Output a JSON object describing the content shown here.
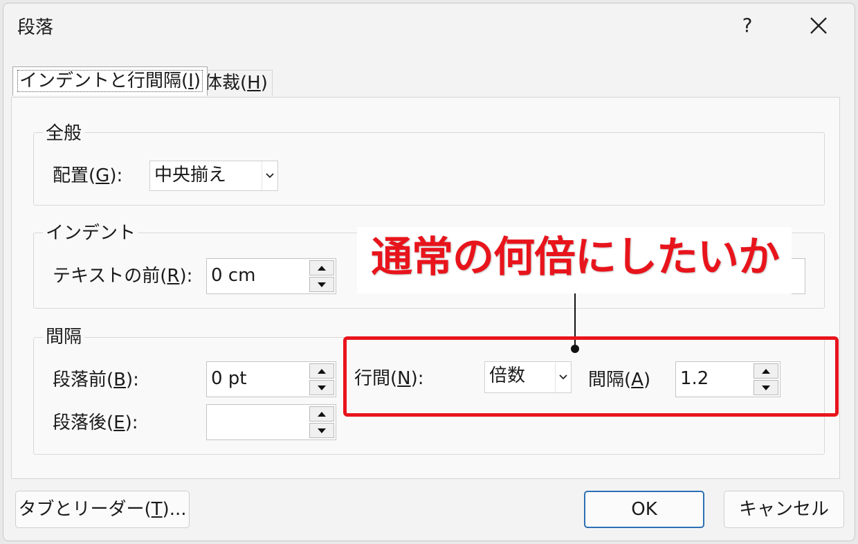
{
  "dialog": {
    "title": "段落",
    "help_label": "?",
    "close_icon": "close-icon"
  },
  "tabs": [
    {
      "label": "インデントと行間隔(I)",
      "pre": "インデントと行間隔(",
      "mn": "I",
      "post": ")",
      "active": true
    },
    {
      "label": "体裁(H)",
      "pre": "体裁(",
      "mn": "H",
      "post": ")",
      "active": false
    }
  ],
  "general": {
    "group_label": "全般",
    "alignment_label_pre": "配置(",
    "alignment_label_mn": "G",
    "alignment_label_post": "):",
    "alignment_value": "中央揃え"
  },
  "indent": {
    "group_label": "インデント",
    "before_text_label_pre": "テキストの前(",
    "before_text_label_mn": "R",
    "before_text_label_post": "):",
    "before_text_value": "0 cm"
  },
  "spacing": {
    "group_label": "間隔",
    "before_label_pre": "段落前(",
    "before_label_mn": "B",
    "before_label_post": "):",
    "before_value": "0 pt",
    "after_label_pre": "段落後(",
    "after_label_mn": "E",
    "after_label_post": "):",
    "after_value": "",
    "line_spacing_label_pre": "行間(",
    "line_spacing_label_mn": "N",
    "line_spacing_label_post": "):",
    "line_spacing_value": "倍数",
    "at_label_pre": "間隔(",
    "at_label_mn": "A",
    "at_label_post": ")",
    "at_value": "1.2"
  },
  "annotation": {
    "callout_text": "通常の何倍にしたいか",
    "color": "#e8141c"
  },
  "footer": {
    "tabs_button_pre": "タブとリーダー(",
    "tabs_button_mn": "T",
    "tabs_button_post": ")...",
    "ok_label": "OK",
    "cancel_label": "キャンセル"
  }
}
